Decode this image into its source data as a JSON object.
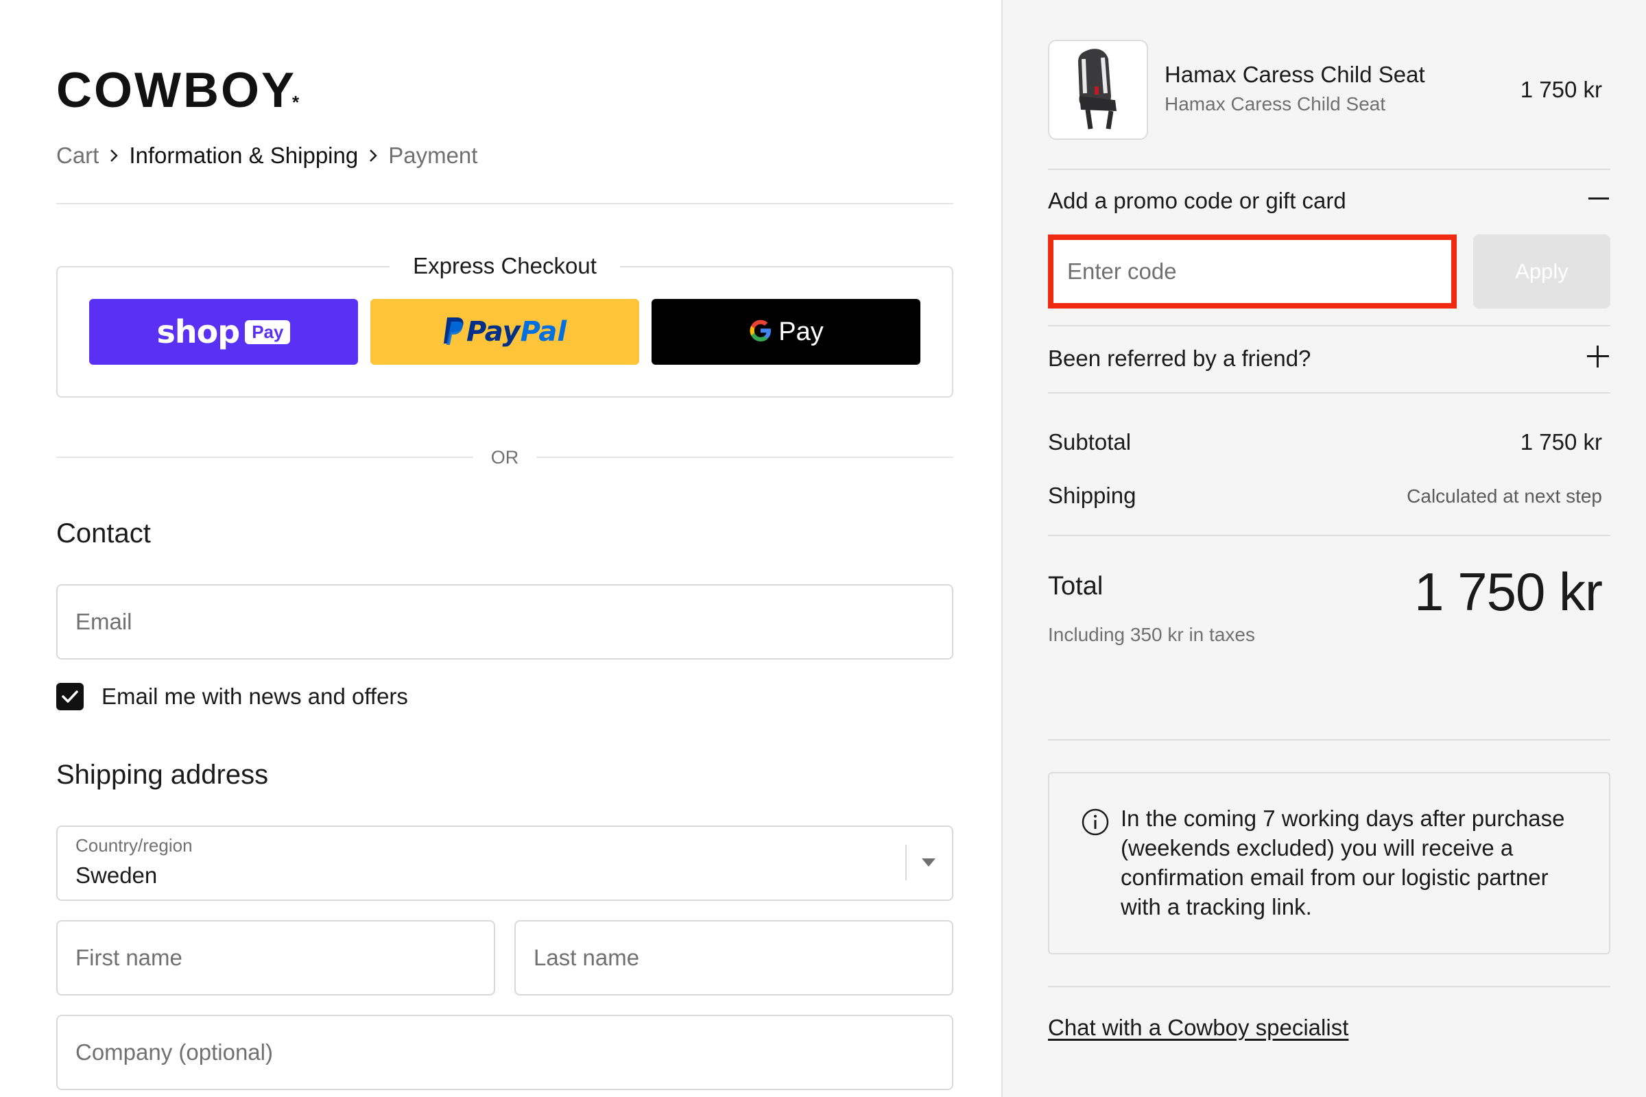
{
  "brand": {
    "logo_text": "COWBOY",
    "logo_mark": "*"
  },
  "breadcrumb": {
    "items": [
      {
        "label": "Cart",
        "state": "link"
      },
      {
        "label": "Information & Shipping",
        "state": "current"
      },
      {
        "label": "Payment",
        "state": "upcoming"
      }
    ],
    "separator_icon": "chevron-right-icon"
  },
  "express_checkout": {
    "title": "Express Checkout",
    "buttons": [
      {
        "id": "shop-pay",
        "label_word": "shop",
        "label_tag": "Pay",
        "bg": "#5a31f4"
      },
      {
        "id": "paypal",
        "label_pay": "Pay",
        "label_pal": "Pal",
        "icon": "paypal-p-icon",
        "bg": "#ffc439"
      },
      {
        "id": "google-pay",
        "label": "Pay",
        "icon": "google-g-icon",
        "bg": "#000000"
      }
    ]
  },
  "divider": {
    "or_label": "OR"
  },
  "contact": {
    "title": "Contact",
    "email_placeholder": "Email",
    "email_value": "",
    "newsletter": {
      "label": "Email me with news and offers",
      "checked": true
    }
  },
  "shipping": {
    "title": "Shipping address",
    "country": {
      "label": "Country/region",
      "value": "Sweden"
    },
    "first_name_placeholder": "First name",
    "last_name_placeholder": "Last name",
    "company_placeholder": "Company (optional)"
  },
  "order": {
    "product": {
      "name": "Hamax Caress Child Seat",
      "variant": "Hamax Caress Child Seat",
      "price": "1 750 kr",
      "thumbnail_icon": "child-seat-icon"
    },
    "promo": {
      "label": "Add a promo code or gift card",
      "toggle_icon": "minus-icon",
      "placeholder": "Enter code",
      "value": "",
      "apply_label": "Apply"
    },
    "referral": {
      "label": "Been referred by a friend?",
      "toggle_icon": "plus-icon"
    },
    "subtotal": {
      "label": "Subtotal",
      "value": "1 750 kr"
    },
    "shipping": {
      "label": "Shipping",
      "value": "Calculated at next step"
    },
    "total": {
      "label": "Total",
      "value": "1 750 kr",
      "tax_note": "Including 350 kr in taxes"
    },
    "info": {
      "icon": "info-icon",
      "text": "In the coming 7 working days after purchase (weekends excluded) you will receive a confirmation email from our logistic partner with a tracking link."
    },
    "chat_link": "Chat with a Cowboy specialist"
  },
  "colors": {
    "accent_shop": "#5a31f4",
    "accent_paypal": "#ffc439",
    "highlight": "#f02a10",
    "sidebar_bg": "#f5f5f5",
    "checkbox": "#111111"
  }
}
